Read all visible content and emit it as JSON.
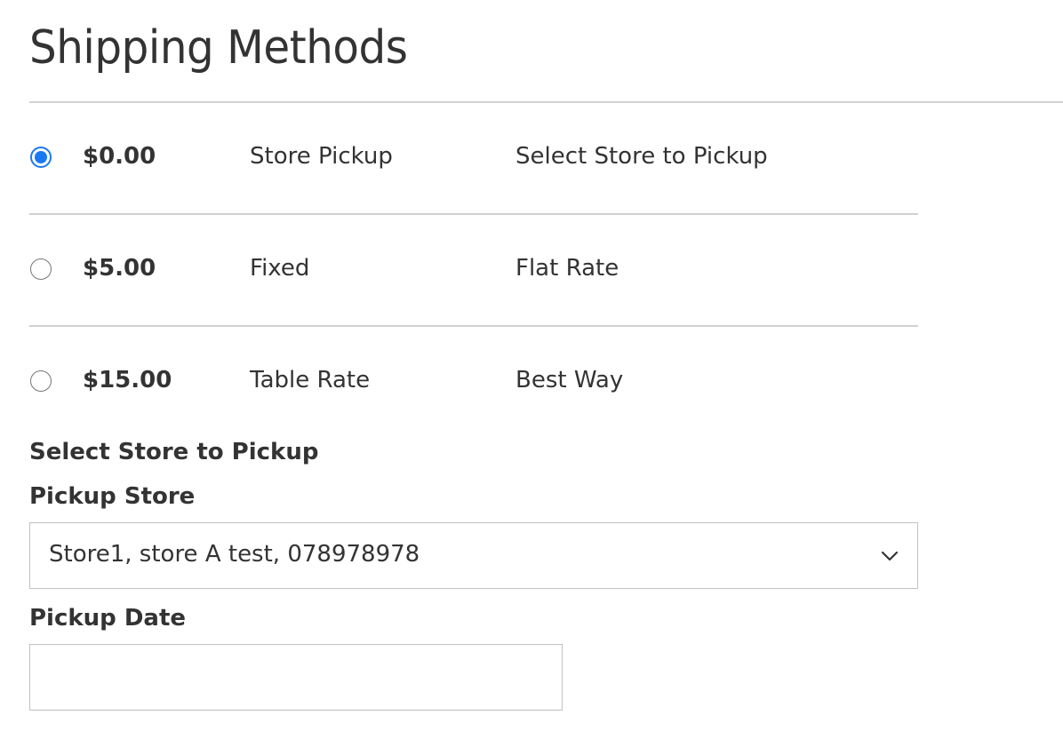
{
  "page": {
    "title": "Shipping Methods"
  },
  "methods": [
    {
      "price": "$0.00",
      "method": "Store Pickup",
      "carrier": "Select Store to Pickup",
      "selected": true
    },
    {
      "price": "$5.00",
      "method": "Fixed",
      "carrier": "Flat Rate",
      "selected": false
    },
    {
      "price": "$15.00",
      "method": "Table Rate",
      "carrier": "Best Way",
      "selected": false
    }
  ],
  "pickup": {
    "section_title": "Select Store to Pickup",
    "store_label": "Pickup Store",
    "store_selected": "Store1, store A test, 078978978",
    "date_label": "Pickup Date",
    "date_value": ""
  },
  "colors": {
    "accent": "#1979f3",
    "text": "#333333",
    "divider": "#d1d1d1",
    "input_border": "#c2c2c2"
  },
  "icons": {
    "select_arrow": "chevron-down-icon"
  }
}
